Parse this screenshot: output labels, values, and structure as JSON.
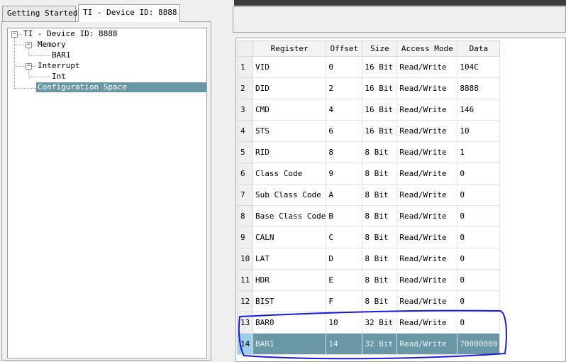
{
  "tabs": [
    {
      "label": "Getting Started",
      "active": false
    },
    {
      "label": "TI - Device ID: 8888",
      "active": true
    }
  ],
  "tree": {
    "root": {
      "label": "TI - Device ID: 8888",
      "toggle": "minus"
    },
    "memory": {
      "label": "Memory",
      "toggle": "minus"
    },
    "bar1": {
      "label": "BAR1"
    },
    "interrupt": {
      "label": "Interrupt",
      "toggle": "minus"
    },
    "int": {
      "label": "Int"
    },
    "config": {
      "label": "Configuration Space",
      "selected": true
    }
  },
  "grid": {
    "columns": [
      "",
      "Register",
      "Offset",
      "Size",
      "Access Mode",
      "Data"
    ],
    "rows": [
      {
        "num": "1",
        "register": "VID",
        "offset": "0",
        "size": "16 Bit",
        "access": "Read/Write",
        "data": "104C"
      },
      {
        "num": "2",
        "register": "DID",
        "offset": "2",
        "size": "16 Bit",
        "access": "Read/Write",
        "data": "8888"
      },
      {
        "num": "3",
        "register": "CMD",
        "offset": "4",
        "size": "16 Bit",
        "access": "Read/Write",
        "data": "146"
      },
      {
        "num": "4",
        "register": "STS",
        "offset": "6",
        "size": "16 Bit",
        "access": "Read/Write",
        "data": "10"
      },
      {
        "num": "5",
        "register": "RID",
        "offset": "8",
        "size": "8 Bit",
        "access": "Read/Write",
        "data": "1"
      },
      {
        "num": "6",
        "register": "Class Code",
        "offset": "9",
        "size": "8 Bit",
        "access": "Read/Write",
        "data": "0"
      },
      {
        "num": "7",
        "register": "Sub Class Code",
        "offset": "A",
        "size": "8 Bit",
        "access": "Read/Write",
        "data": "0"
      },
      {
        "num": "8",
        "register": "Base Class Code",
        "offset": "B",
        "size": "8 Bit",
        "access": "Read/Write",
        "data": "0"
      },
      {
        "num": "9",
        "register": "CALN",
        "offset": "C",
        "size": "8 Bit",
        "access": "Read/Write",
        "data": "0"
      },
      {
        "num": "10",
        "register": "LAT",
        "offset": "D",
        "size": "8 Bit",
        "access": "Read/Write",
        "data": "0"
      },
      {
        "num": "11",
        "register": "HDR",
        "offset": "E",
        "size": "8 Bit",
        "access": "Read/Write",
        "data": "0"
      },
      {
        "num": "12",
        "register": "BIST",
        "offset": "F",
        "size": "8 Bit",
        "access": "Read/Write",
        "data": "0"
      },
      {
        "num": "13",
        "register": "BAR0",
        "offset": "10",
        "size": "32 Bit",
        "access": "Read/Write",
        "data": "0"
      },
      {
        "num": "14",
        "register": "BAR1",
        "offset": "14",
        "size": "32 Bit",
        "access": "Read/Write",
        "data": "70000000",
        "selected": true
      }
    ]
  },
  "colors": {
    "selection": "#6a97a6",
    "row_header_selected": "#9ad0ec",
    "annotation_ink": "#1a1ad8",
    "titlebar": "#3c3c3c"
  }
}
